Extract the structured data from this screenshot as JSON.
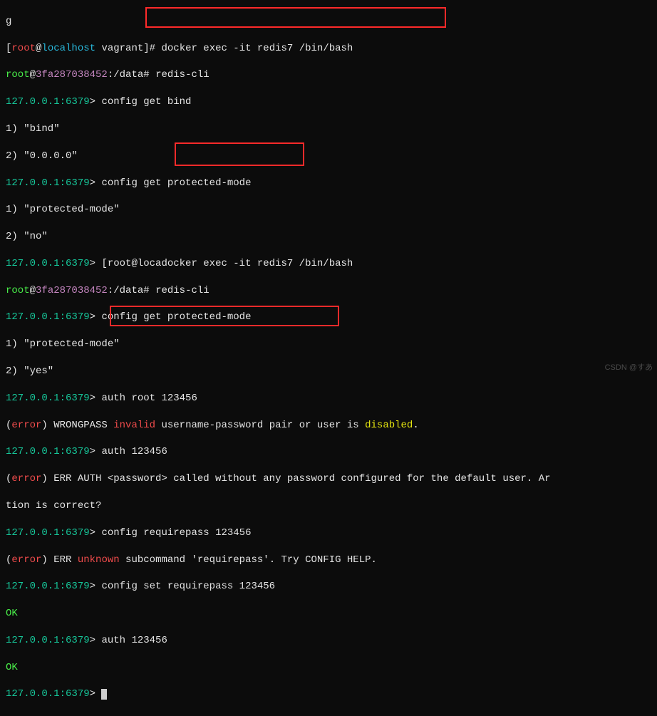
{
  "lines": {
    "l0a": "g",
    "l1_prompt_open": "[",
    "l1_user": "root",
    "l1_at": "@",
    "l1_host": "localhost",
    "l1_dir": " vagrant",
    "l1_close": "]# ",
    "l1_cmd": "docker exec -it redis7 /bin/bash",
    "l2_user": "root",
    "l2_at": "@",
    "l2_host": "3fa287038452",
    "l2_path": ":/data# ",
    "l2_cmd": "redis-cli",
    "l3_ipport": "127.0.0.1:6379",
    "l3_gt": "> ",
    "l3_cmd": "config get bind",
    "l4": "1) \"bind\"",
    "l5": "2) \"0.0.0.0\"",
    "l6_cmd": "config get protected-mode",
    "l7": "1) \"protected-mode\"",
    "l8": "2) \"no\"",
    "l9_pre": "[root@loca",
    "l9_docker": "docker exec -it redis7 /bin/bash",
    "l10_user": "root",
    "l10_at": "@",
    "l10_host": "3fa287038452",
    "l10_path": ":/data# ",
    "l10_cmd": "redis-cli",
    "l11_cmd": "config get protected-mode",
    "l12": "1) \"protected-mode\"",
    "l13": "2) \"yes\"",
    "l14_cmd": "auth root 123456",
    "l15_err": "(",
    "l15_errw": "error",
    "l15_err2": ") WRONGPASS ",
    "l15_invalid": "invalid",
    "l15_rest": " username-password pair or user is ",
    "l15_disabled": "disabled",
    "l15_dot": ".",
    "l16_cmd": "auth 123456",
    "l17_pre": "(",
    "l17_err": "error",
    "l17_rest": ") ERR AUTH <password> called without any password configured for the default user. Ar",
    "l18": "tion is correct?",
    "l19_cmd": "config requirepass 123456",
    "l20_pre": "(",
    "l20_err": "error",
    "l20_mid": ") ERR ",
    "l20_unk": "unknown",
    "l20_rest": " subcommand 'requirepass'. Try CONFIG HELP.",
    "l21_cmd": "config set requirepass 123456",
    "l22_ok": "OK",
    "l23_cmd": "auth 123456",
    "l24_ok": "OK",
    "watermark": "CSDN @すあ"
  }
}
